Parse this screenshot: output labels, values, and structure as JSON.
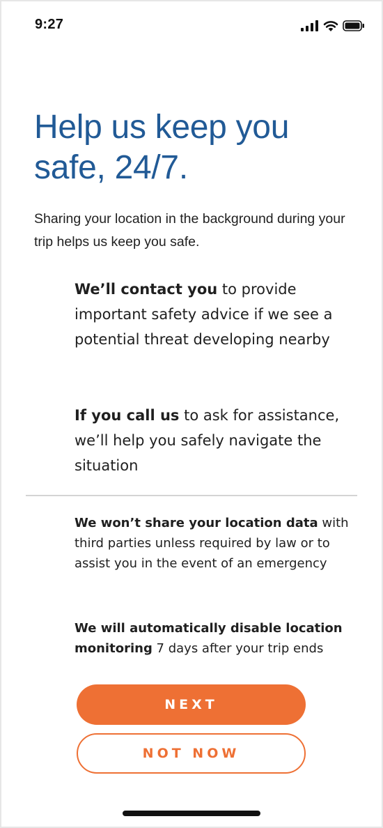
{
  "status_bar": {
    "time": "9:27",
    "icons": [
      "signal-icon",
      "wifi-icon",
      "battery-icon"
    ]
  },
  "headline": "Help us keep you safe, 24/7.",
  "intro": "Sharing your location in the background during your trip helps us keep you safe.",
  "bullets": [
    {
      "lead": "We’ll contact you",
      "text": " to provide important safety advice if we see a potential threat developing nearby"
    },
    {
      "lead": "If you call us",
      "text": " to ask for assistance, we’ll help you safely navigate the situation"
    }
  ],
  "notes": [
    {
      "lead": "We won’t share your location data",
      "text": " with third parties unless required by law or to assist you in the event of an emergency"
    },
    {
      "lead": "We will automatically disable location monitoring",
      "text": " 7 days after your trip ends"
    }
  ],
  "buttons": {
    "next": "NEXT",
    "not_now": "NOT NOW"
  },
  "colors": {
    "headline": "#215a96",
    "accent": "#ee7034",
    "text": "#1f1f1f",
    "divider": "#d4d4d4"
  }
}
